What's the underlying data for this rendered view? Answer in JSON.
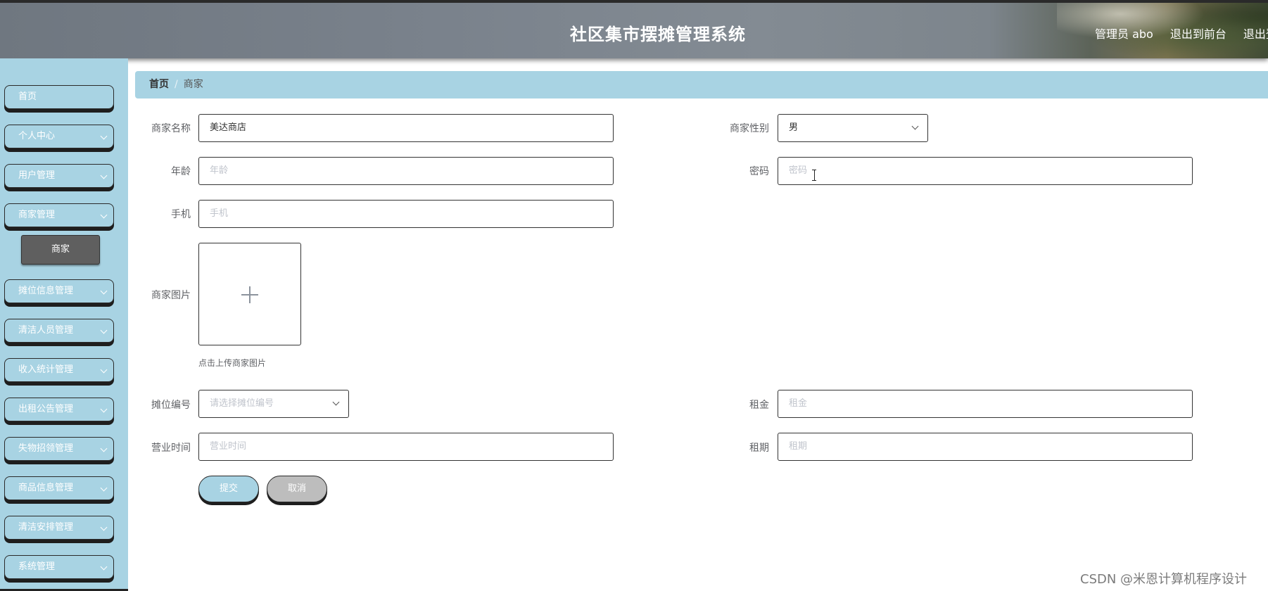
{
  "header": {
    "title": "社区集市摆摊管理系统",
    "links": [
      "管理员 abo",
      "退出到前台",
      "退出登"
    ]
  },
  "sidebar": {
    "items": [
      {
        "label": "首页",
        "has_arrow": false
      },
      {
        "label": "个人中心",
        "has_arrow": true
      },
      {
        "label": "用户管理",
        "has_arrow": true
      },
      {
        "label": "商家管理",
        "has_arrow": true
      },
      {
        "label": "摊位信息管理",
        "has_arrow": true
      },
      {
        "label": "清洁人员管理",
        "has_arrow": true
      },
      {
        "label": "收入统计管理",
        "has_arrow": true
      },
      {
        "label": "出租公告管理",
        "has_arrow": true
      },
      {
        "label": "失物招领管理",
        "has_arrow": true
      },
      {
        "label": "商品信息管理",
        "has_arrow": true
      },
      {
        "label": "清洁安排管理",
        "has_arrow": true
      },
      {
        "label": "系统管理",
        "has_arrow": true
      }
    ],
    "active_sub": "商家"
  },
  "breadcrumb": {
    "home": "首页",
    "separator": "/",
    "current": "商家"
  },
  "form": {
    "merchant_name": {
      "label": "商家名称",
      "value": "美达商店"
    },
    "merchant_gender": {
      "label": "商家性别",
      "value": "男"
    },
    "age": {
      "label": "年龄",
      "placeholder": "年龄"
    },
    "password": {
      "label": "密码",
      "placeholder": "密码"
    },
    "phone": {
      "label": "手机",
      "placeholder": "手机"
    },
    "merchant_image": {
      "label": "商家图片",
      "hint": "点击上传商家图片"
    },
    "stall_no": {
      "label": "摊位编号",
      "placeholder": "请选择摊位编号"
    },
    "rent": {
      "label": "租金",
      "placeholder": "租金"
    },
    "business_hours": {
      "label": "营业时间",
      "placeholder": "营业时间"
    },
    "lease_term": {
      "label": "租期",
      "placeholder": "租期"
    },
    "submit_label": "提交",
    "cancel_label": "取消"
  },
  "watermark": "CSDN @米恩计算机程序设计",
  "colors": {
    "accent": "#a8d3e3",
    "active_sub": "#5f5f5f",
    "cancel": "#bdbdbd"
  }
}
